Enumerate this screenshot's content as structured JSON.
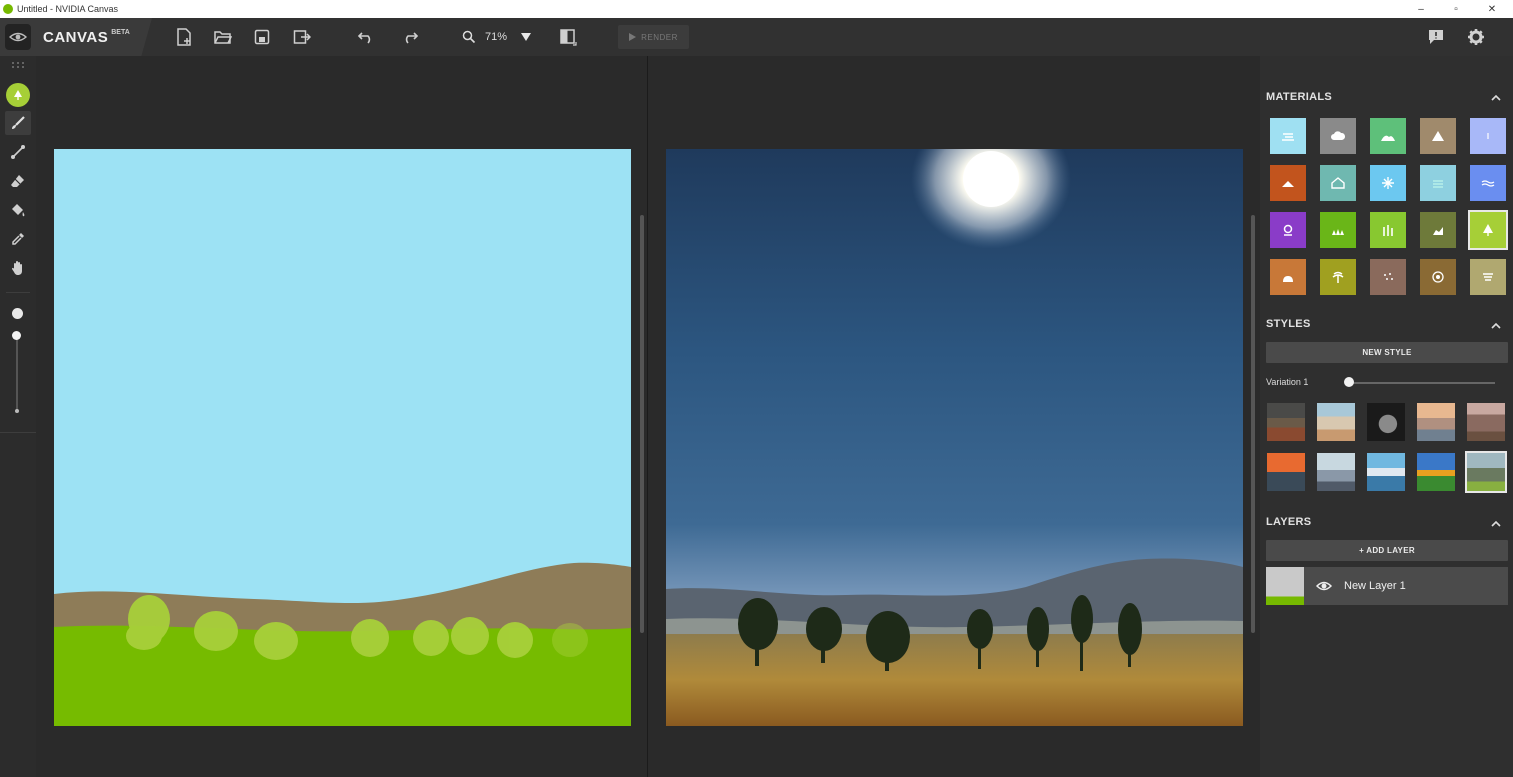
{
  "window": {
    "title": "Untitled - NVIDIA Canvas",
    "controls": {
      "minimize": "–",
      "maximize": "▫",
      "close": "✕"
    }
  },
  "app": {
    "logo_text": "CANVAS",
    "beta_label": "BETA",
    "nvidia_label": "NVIDIA"
  },
  "toolbar": {
    "zoom_value": "71%",
    "render_label": "RENDER"
  },
  "tools": [
    "brush",
    "line",
    "eraser",
    "fill",
    "eyedropper",
    "pan"
  ],
  "panels": {
    "materials": {
      "title": "MATERIALS",
      "items": [
        {
          "name": "sky-water",
          "color": "#9fe0f2"
        },
        {
          "name": "cloud",
          "color": "#8a8a8a"
        },
        {
          "name": "hill",
          "color": "#5ec07a"
        },
        {
          "name": "mountain",
          "color": "#a08a6c"
        },
        {
          "name": "sky-light",
          "color": "#a8b8f8"
        },
        {
          "name": "dirt",
          "color": "#c2541d"
        },
        {
          "name": "house",
          "color": "#6fb8b0"
        },
        {
          "name": "snow",
          "color": "#6cc8f0"
        },
        {
          "name": "fog",
          "color": "#8ed0e0"
        },
        {
          "name": "water",
          "color": "#6a8ef0"
        },
        {
          "name": "flower",
          "color": "#8a3cc8"
        },
        {
          "name": "grass",
          "color": "#6ab618"
        },
        {
          "name": "tall-grass",
          "color": "#88c830"
        },
        {
          "name": "rock",
          "color": "#6e7a3a"
        },
        {
          "name": "tree",
          "color": "#a6cf37"
        },
        {
          "name": "stone",
          "color": "#c87838"
        },
        {
          "name": "palm",
          "color": "#a0a020"
        },
        {
          "name": "gravel",
          "color": "#8a6a5c"
        },
        {
          "name": "wood",
          "color": "#8a6a34"
        },
        {
          "name": "sand",
          "color": "#b0a870"
        }
      ]
    },
    "styles": {
      "title": "STYLES",
      "new_style_label": "NEW STYLE",
      "variation_label": "Variation 1",
      "variation_value": 0
    },
    "layers": {
      "title": "LAYERS",
      "add_layer_label": "+ ADD LAYER",
      "items": [
        {
          "name": "New Layer 1"
        }
      ]
    }
  }
}
